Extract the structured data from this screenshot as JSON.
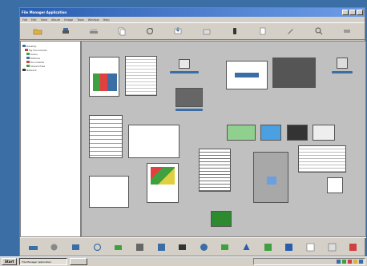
{
  "window": {
    "title": "File Manager Application"
  },
  "menubar": {
    "items": [
      "File",
      "Edit",
      "View",
      "Album",
      "Image",
      "Tools",
      "Window",
      "Help"
    ]
  },
  "toolbar": {
    "icons": [
      "folder-icon",
      "printer-icon",
      "scanner-icon",
      "copy-icon",
      "rotate-icon",
      "import-icon",
      "export-icon",
      "hand-icon",
      "page-icon",
      "edit-icon",
      "zoom-icon",
      "settings-icon"
    ]
  },
  "tree": {
    "items": [
      {
        "label": "Desktop",
        "color": "#3a6ea5"
      },
      {
        "label": "My Documents",
        "color": "#d04040"
      },
      {
        "label": "Scans",
        "color": "#40a040"
      },
      {
        "label": "Pictures",
        "color": "#3a6ea5"
      },
      {
        "label": "Documents",
        "color": "#d04040"
      },
      {
        "label": "Shared Files",
        "color": "#40a040"
      },
      {
        "label": "Network",
        "color": "#333333"
      }
    ]
  },
  "bottombar": {
    "icons": [
      "scan-icon",
      "fax-icon",
      "ocr-icon",
      "sync-icon",
      "camera-icon",
      "calendar-icon",
      "photo-icon",
      "movie-icon",
      "globe-icon",
      "mail-icon",
      "print-icon",
      "calculator-icon",
      "web-icon",
      "editor-icon",
      "chart-icon",
      "stamp-icon"
    ]
  },
  "taskbar": {
    "start_label": "Start",
    "task_label": "File Manager Application"
  },
  "colors": {
    "desktop": "#3a6ea5",
    "window": "#d4d0c8",
    "canvas": "#c0c0c0",
    "accent": "#2a5db0"
  }
}
